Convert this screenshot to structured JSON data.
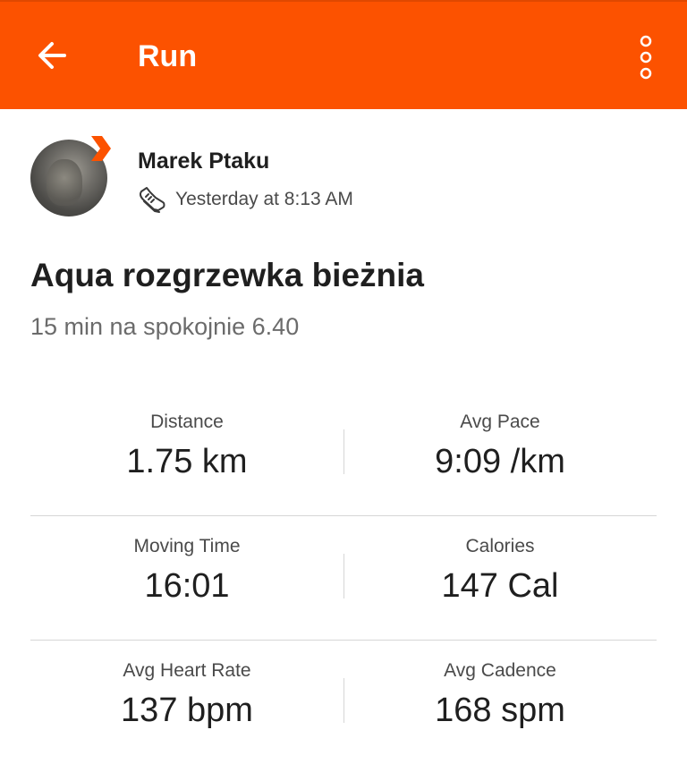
{
  "header": {
    "back_icon": "arrow-left-icon",
    "title": "Run",
    "menu_icon": "more-vertical-icon",
    "accent_color": "#fc5200"
  },
  "athlete": {
    "name": "Marek Ptaku",
    "activity_icon": "running-shoe-icon",
    "timestamp": "Yesterday at 8:13 AM"
  },
  "activity": {
    "title": "Aqua rozgrzewka bieżnia",
    "description": "15 min na spokojnie 6.40"
  },
  "stats": [
    {
      "left": {
        "label": "Distance",
        "value": "1.75 km"
      },
      "right": {
        "label": "Avg Pace",
        "value": "9:09 /km"
      }
    },
    {
      "left": {
        "label": "Moving Time",
        "value": "16:01"
      },
      "right": {
        "label": "Calories",
        "value": "147 Cal"
      }
    },
    {
      "left": {
        "label": "Avg Heart Rate",
        "value": "137 bpm"
      },
      "right": {
        "label": "Avg Cadence",
        "value": "168 spm"
      }
    }
  ]
}
